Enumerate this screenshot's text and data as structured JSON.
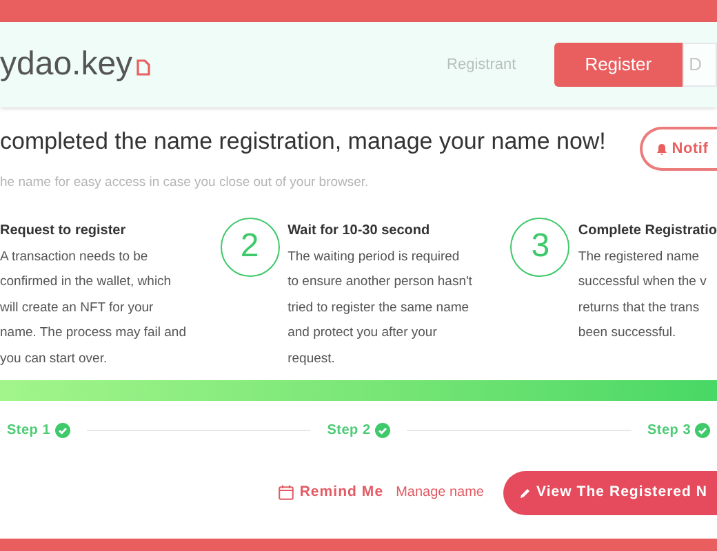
{
  "header": {
    "logo": "ydao.key",
    "tabs": [
      {
        "label": "Registrant",
        "selected": false
      },
      {
        "label": "Register",
        "selected": true
      },
      {
        "label": "D",
        "selected": false
      }
    ]
  },
  "title": "completed the name registration, manage your name now!",
  "subtitle": "he name for easy access in case you close out of your browser.",
  "notify_button": "Notif",
  "steps": [
    {
      "title": "Request to register",
      "lines": [
        "A transaction needs to be",
        "confirmed in the wallet, which",
        "will create an NFT for your",
        "name. The process may fail and",
        "you can start over."
      ]
    },
    {
      "number": "2",
      "title": "Wait for 10-30 second",
      "lines": [
        "The waiting period is required",
        "to ensure another person hasn't",
        "tried to register the same name",
        "and protect you after your",
        "request."
      ]
    },
    {
      "number": "3",
      "title": "Complete Registratio",
      "lines": [
        "The registered name",
        "successful when the v",
        "returns that the trans",
        "been successful."
      ]
    }
  ],
  "progress": {
    "level": 1
  },
  "step_labels": [
    {
      "label": "Step 1",
      "done": true
    },
    {
      "label": "Step 2",
      "done": true
    },
    {
      "label": "Step 3",
      "done": true
    }
  ],
  "remind_button": "Remind Me",
  "manage_link": "Manage name",
  "view_button": "View The Registered N"
}
